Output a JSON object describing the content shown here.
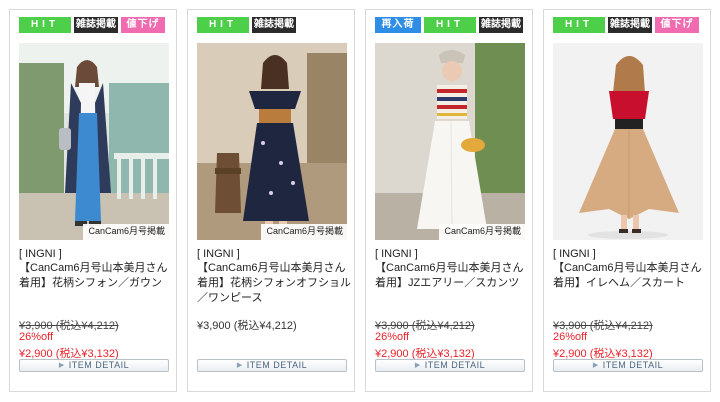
{
  "products": [
    {
      "badges": [
        {
          "text": "HIT",
          "kind": "hit"
        },
        {
          "text": "雑誌掲載",
          "kind": "mag"
        },
        {
          "text": "値下げ",
          "kind": "down"
        }
      ],
      "credit": "CanCam6月号掲載",
      "brand": "[ INGNI ]",
      "name": "【CanCam6月号山本美月さん着用】花柄シフォン／ガウン",
      "price_original": "¥3,900 (税込¥4,212)",
      "discount": "26%off",
      "price_sale": "¥2,900 (税込¥3,132)",
      "detail_label": "ITEM DETAIL"
    },
    {
      "badges": [
        {
          "text": "HIT",
          "kind": "hit"
        },
        {
          "text": "雑誌掲載",
          "kind": "mag"
        }
      ],
      "credit": "CanCam6月号掲載",
      "brand": "[ INGNI ]",
      "name": "【CanCam6月号山本美月さん着用】花柄シフォンオフショル／ワンピース",
      "price": "¥3,900 (税込¥4,212)",
      "detail_label": "ITEM DETAIL"
    },
    {
      "badges": [
        {
          "text": "再入荷",
          "kind": "new"
        },
        {
          "text": "HIT",
          "kind": "hit"
        },
        {
          "text": "雑誌掲載",
          "kind": "mag"
        }
      ],
      "credit": "CanCam6月号掲載",
      "brand": "[ INGNI ]",
      "name": "【CanCam6月号山本美月さん着用】JZエアリー／スカンツ",
      "price_original": "¥3,900 (税込¥4,212)",
      "discount": "26%off",
      "price_sale": "¥2,900 (税込¥3,132)",
      "detail_label": "ITEM DETAIL"
    },
    {
      "badges": [
        {
          "text": "HIT",
          "kind": "hit"
        },
        {
          "text": "雑誌掲載",
          "kind": "mag"
        },
        {
          "text": "値下げ",
          "kind": "down"
        }
      ],
      "brand": "[ INGNI ]",
      "name": "【CanCam6月号山本美月さん着用】イレヘム／スカート",
      "price_original": "¥3,900 (税込¥4,212)",
      "discount": "26%off",
      "price_sale": "¥2,900 (税込¥3,132)",
      "detail_label": "ITEM DETAIL"
    }
  ],
  "colors": {
    "hit": "#4ecf4a",
    "magazine": "#2b2b2b",
    "price_down": "#f06bb0",
    "restock": "#2e8ee6",
    "sale_red": "#e8232a"
  }
}
